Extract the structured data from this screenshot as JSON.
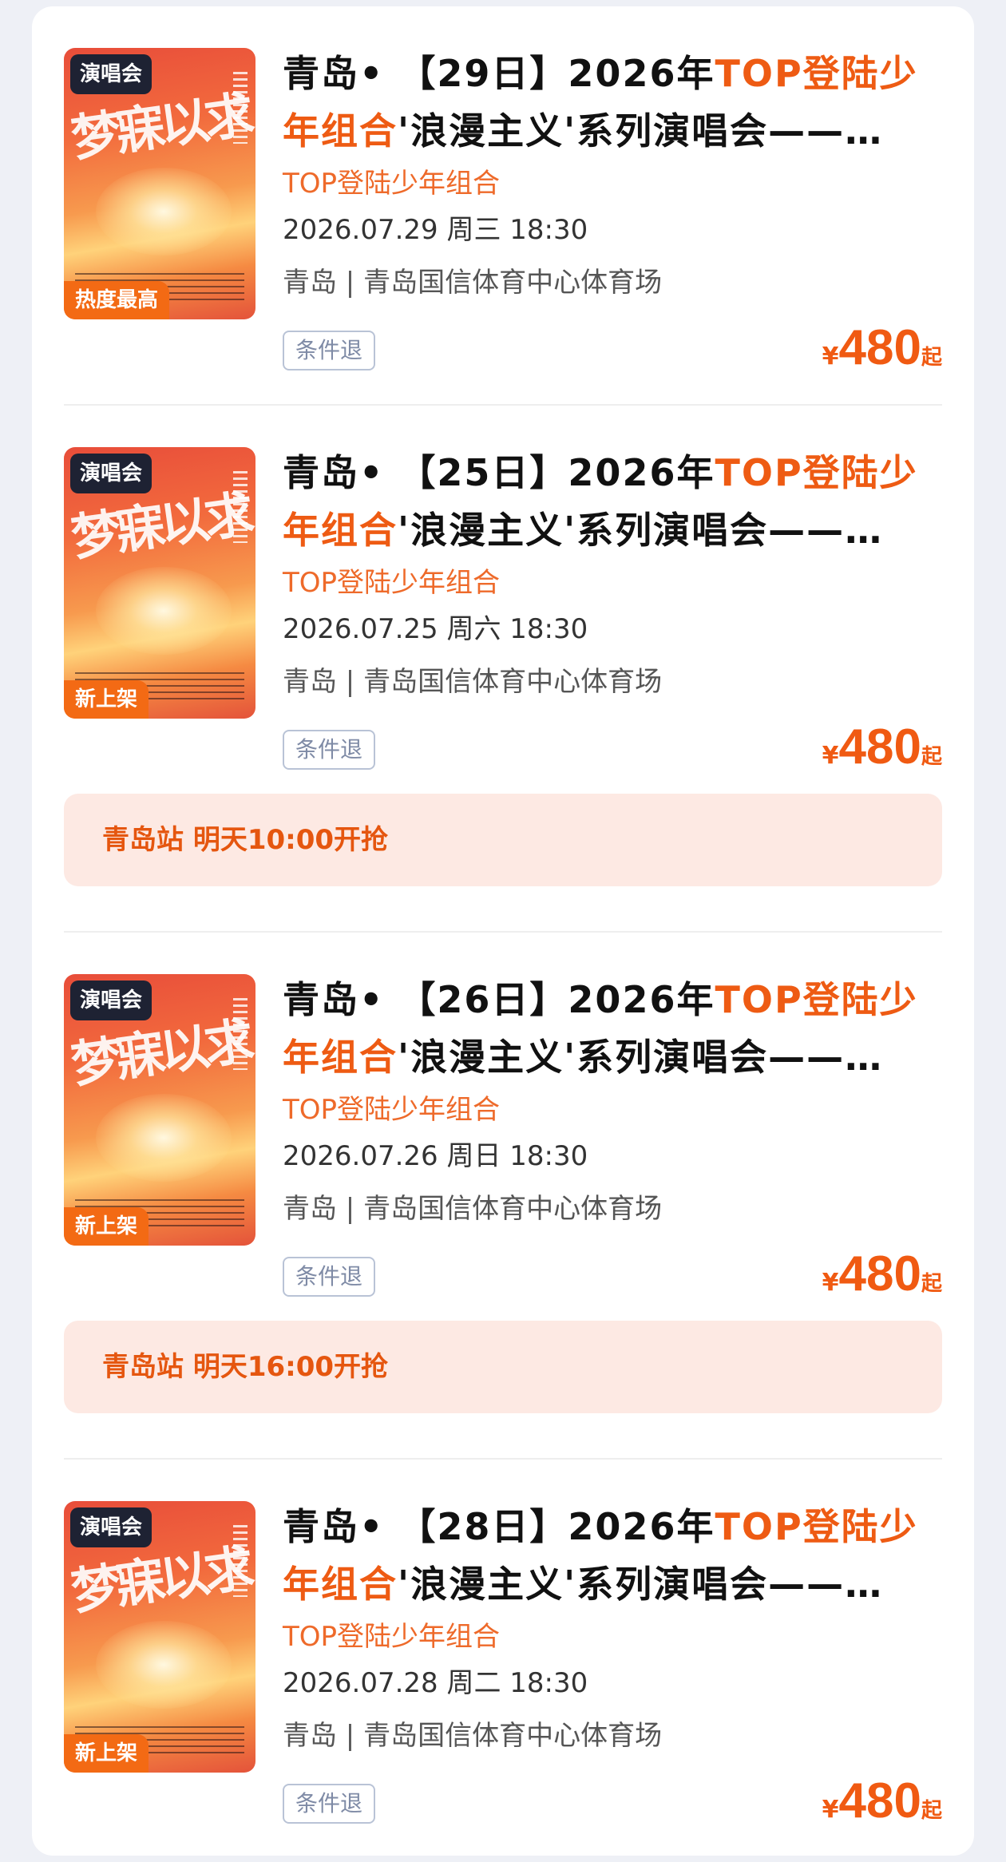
{
  "items": [
    {
      "title_prefix": "青岛• 【29日】2026年",
      "title_highlight": "TOP登陆少年组合",
      "title_suffix": "'浪漫主义'系列演唱会——…",
      "artist": "TOP登陆少年组合",
      "datetime": "2026.07.29 周三 18:30",
      "venue": "青岛 | 青岛国信体育中心体育场",
      "category_tag": "演唱会",
      "status_tag": "热度最高",
      "refund_label": "条件退",
      "price_currency": "¥",
      "price_value": "480",
      "price_suffix": "起",
      "banner": null
    },
    {
      "title_prefix": "青岛• 【25日】2026年",
      "title_highlight": "TOP登陆少年组合",
      "title_suffix": "'浪漫主义'系列演唱会——…",
      "artist": "TOP登陆少年组合",
      "datetime": "2026.07.25 周六 18:30",
      "venue": "青岛 | 青岛国信体育中心体育场",
      "category_tag": "演唱会",
      "status_tag": "新上架",
      "refund_label": "条件退",
      "price_currency": "¥",
      "price_value": "480",
      "price_suffix": "起",
      "banner": "青岛站 明天10:00开抢"
    },
    {
      "title_prefix": "青岛• 【26日】2026年",
      "title_highlight": "TOP登陆少年组合",
      "title_suffix": "'浪漫主义'系列演唱会——…",
      "artist": "TOP登陆少年组合",
      "datetime": "2026.07.26 周日 18:30",
      "venue": "青岛 | 青岛国信体育中心体育场",
      "category_tag": "演唱会",
      "status_tag": "新上架",
      "refund_label": "条件退",
      "price_currency": "¥",
      "price_value": "480",
      "price_suffix": "起",
      "banner": "青岛站 明天16:00开抢"
    },
    {
      "title_prefix": "青岛• 【28日】2026年",
      "title_highlight": "TOP登陆少年组合",
      "title_suffix": "'浪漫主义'系列演唱会——…",
      "artist": "TOP登陆少年组合",
      "datetime": "2026.07.28 周二 18:30",
      "venue": "青岛 | 青岛国信体育中心体育场",
      "category_tag": "演唱会",
      "status_tag": "新上架",
      "refund_label": "条件退",
      "price_currency": "¥",
      "price_value": "480",
      "price_suffix": "起",
      "banner": null
    }
  ]
}
